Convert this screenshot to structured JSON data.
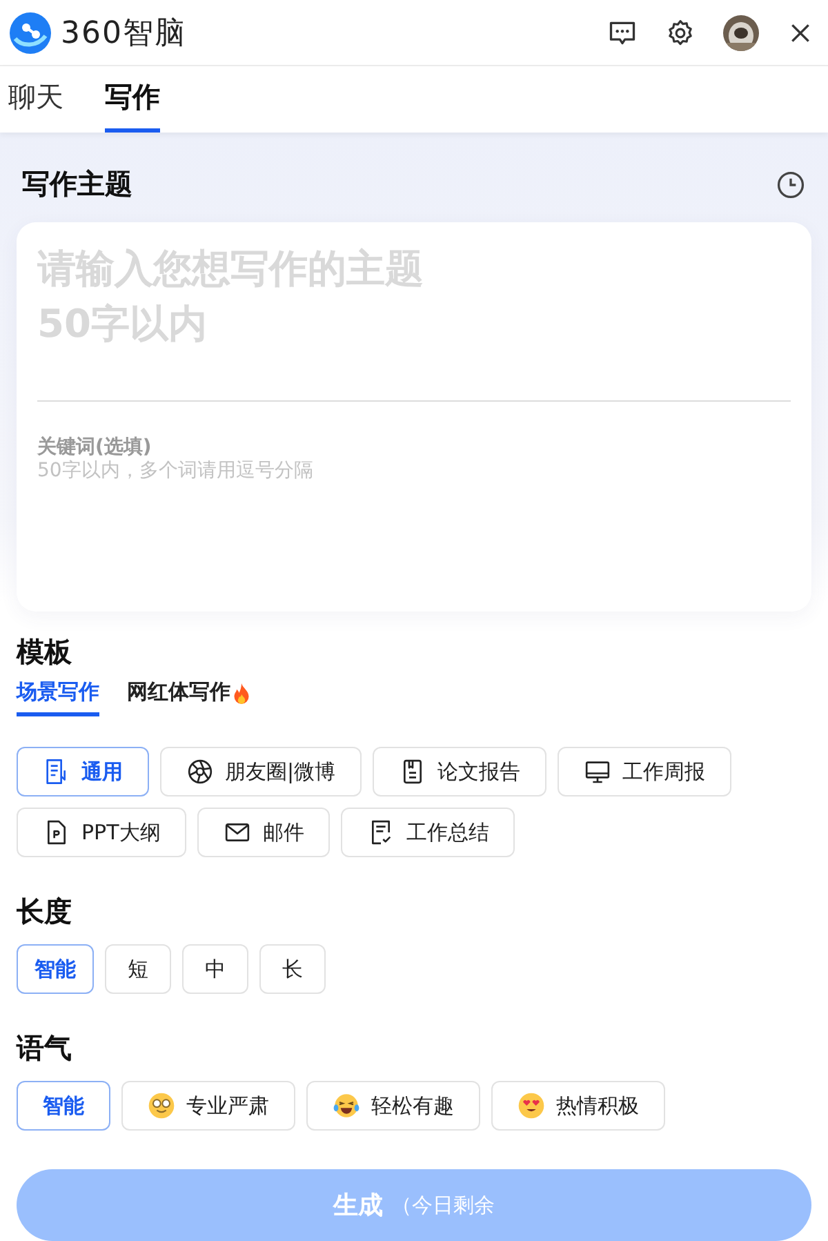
{
  "header": {
    "logo_text": "360智脑"
  },
  "tabs": [
    {
      "label": "聊天",
      "selected": false
    },
    {
      "label": "写作",
      "selected": true
    }
  ],
  "topic": {
    "title": "写作主题",
    "placeholder": "请输入您想写作的主题\n50字以内",
    "keywords_label": "关键词(选填)",
    "keywords_placeholder": "50字以内，多个词请用逗号分隔"
  },
  "template": {
    "title": "模板",
    "tabs": [
      {
        "label": "场景写作",
        "selected": true,
        "hot": false
      },
      {
        "label": "网红体写作",
        "selected": false,
        "hot": true
      }
    ],
    "options": [
      {
        "label": "通用",
        "kind": "doc",
        "selected": true
      },
      {
        "label": "朋友圈|微博",
        "kind": "aperture",
        "selected": false
      },
      {
        "label": "论文报告",
        "kind": "notebook",
        "selected": false
      },
      {
        "label": "工作周报",
        "kind": "monitor",
        "selected": false
      },
      {
        "label": "PPT大纲",
        "kind": "ppt",
        "selected": false
      },
      {
        "label": "邮件",
        "kind": "mail",
        "selected": false
      },
      {
        "label": "工作总结",
        "kind": "checklist",
        "selected": false
      }
    ]
  },
  "length": {
    "title": "长度",
    "options": [
      {
        "label": "智能",
        "selected": true
      },
      {
        "label": "短",
        "selected": false
      },
      {
        "label": "中",
        "selected": false
      },
      {
        "label": "长",
        "selected": false
      }
    ]
  },
  "tone": {
    "title": "语气",
    "options": [
      {
        "label": "智能",
        "kind": "plain",
        "selected": true
      },
      {
        "label": "专业严肃",
        "kind": "nerd",
        "selected": false
      },
      {
        "label": "轻松有趣",
        "kind": "laugh",
        "selected": false
      },
      {
        "label": "热情积极",
        "kind": "hearts",
        "selected": false
      }
    ]
  },
  "generate": {
    "label": "生成",
    "note": "（今日剩余",
    "disabled": true
  }
}
